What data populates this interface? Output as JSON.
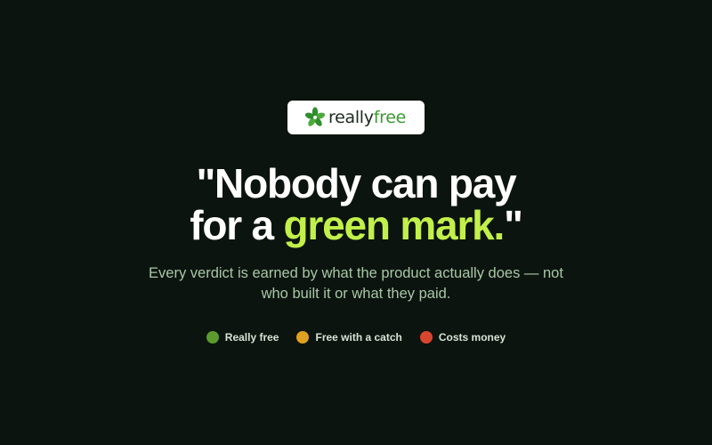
{
  "logo": {
    "word1": "really",
    "word2": "free"
  },
  "headline": {
    "line1": "\"Nobody can pay",
    "line2_prefix": "for a ",
    "line2_highlight": "green mark.",
    "line2_suffix": "\""
  },
  "subtitle": "Every verdict is earned by what the product actually does — not who built it or what they paid.",
  "legend": [
    {
      "label": "Really free",
      "color": "#5c9a2e"
    },
    {
      "label": "Free with a catch",
      "color": "#e0a020"
    },
    {
      "label": "Costs money",
      "color": "#d9452e"
    }
  ],
  "colors": {
    "background": "#0b140e",
    "accent": "#c2f04a",
    "brand_green": "#3a9a32"
  }
}
